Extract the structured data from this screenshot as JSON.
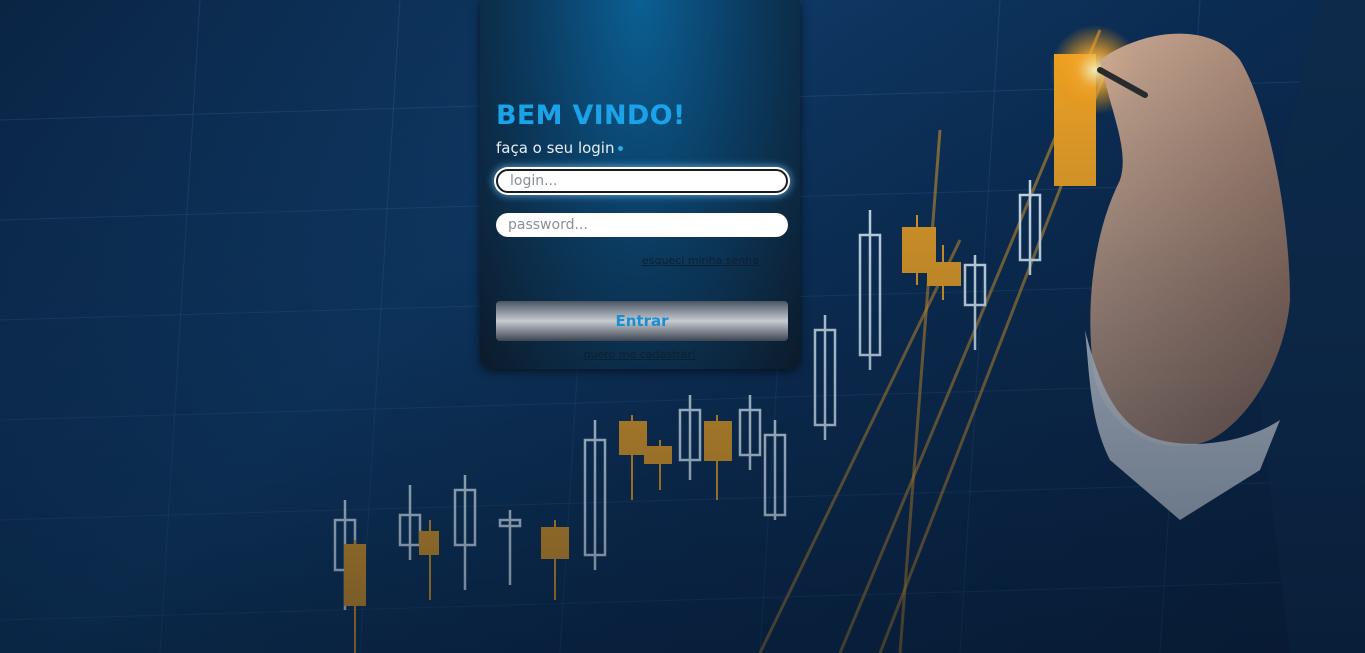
{
  "login": {
    "title": "BEM VINDO!",
    "subtitle": "faça o seu login",
    "login_placeholder": "login...",
    "password_placeholder": "password...",
    "forgot_password_label": "esqueci minha senha",
    "submit_label": "Entrar",
    "register_label": "quero me cadastrar!"
  },
  "colors": {
    "accent": "#1aa3e8",
    "card_top": "#0b5f93",
    "card_bottom": "#0c1a2a",
    "candle_orange": "#f5a623",
    "candle_white": "#dff3ff"
  }
}
